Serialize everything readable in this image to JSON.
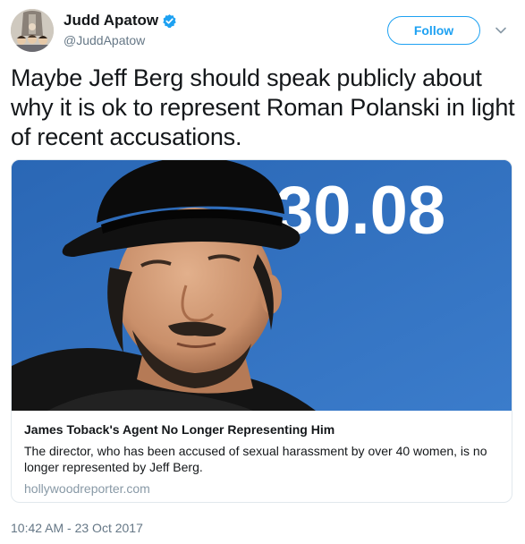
{
  "author": {
    "display_name": "Judd Apatow",
    "handle": "@JuddApatow",
    "verified": true
  },
  "follow_label": "Follow",
  "tweet_text": "Maybe Jeff Berg should speak publicly about why it is ok to represent Roman Polanski in light of recent accusations.",
  "card": {
    "image_text": "30.08",
    "title": "James Toback's Agent No Longer Representing Him",
    "description": "The director, who has been accused of sexual harassment by over 40 women, is no longer represented by Jeff Berg.",
    "domain": "hollywoodreporter.com"
  },
  "timestamp": "10:42 AM - 23 Oct 2017",
  "colors": {
    "accent": "#1da1f2",
    "secondary_text": "#657786",
    "card_border": "#e1e8ed",
    "image_background": "#2e6fbd"
  },
  "icons": {
    "verified": "verified-badge-icon",
    "more": "chevron-down-icon"
  }
}
